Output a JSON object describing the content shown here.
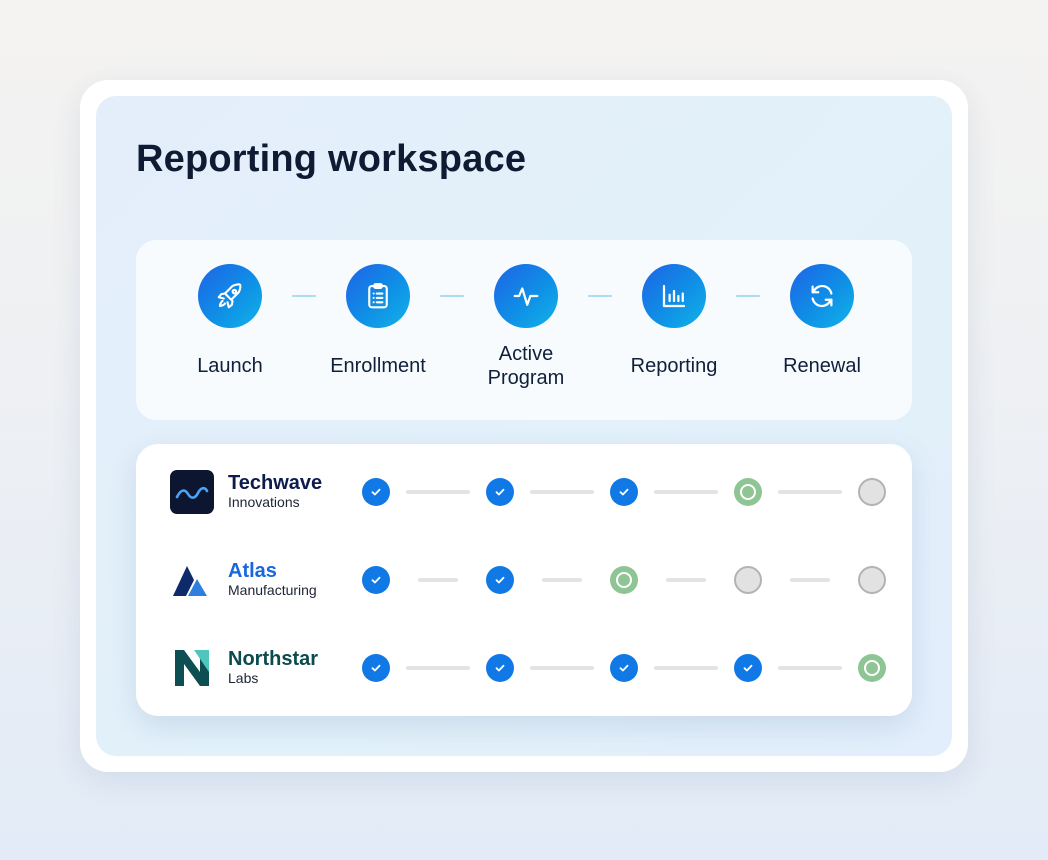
{
  "title": "Reporting workspace",
  "stages": [
    {
      "label": "Launch",
      "icon": "rocket-icon"
    },
    {
      "label": "Enrollment",
      "icon": "clipboard-icon"
    },
    {
      "label": "Active Program",
      "icon": "activity-pulse-icon"
    },
    {
      "label": "Reporting",
      "icon": "bar-chart-icon"
    },
    {
      "label": "Renewal",
      "icon": "refresh-icon"
    }
  ],
  "companies": [
    {
      "name": "Techwave",
      "subtitle": "Innovations",
      "name_color": "#0d1b4d",
      "logo": "techwave-logo",
      "statuses": [
        "done",
        "done",
        "done",
        "current",
        "pending"
      ]
    },
    {
      "name": "Atlas",
      "subtitle": "Manufacturing",
      "name_color": "#1767e0",
      "logo": "atlas-logo",
      "statuses": [
        "done",
        "done",
        "current",
        "pending",
        "pending"
      ]
    },
    {
      "name": "Northstar",
      "subtitle": "Labs",
      "name_color": "#0c4a4e",
      "logo": "northstar-logo",
      "statuses": [
        "done",
        "done",
        "done",
        "done",
        "current"
      ]
    }
  ],
  "colors": {
    "accent": "#1179e6",
    "current": "#8fc595",
    "pending": "#e2e2e2"
  }
}
